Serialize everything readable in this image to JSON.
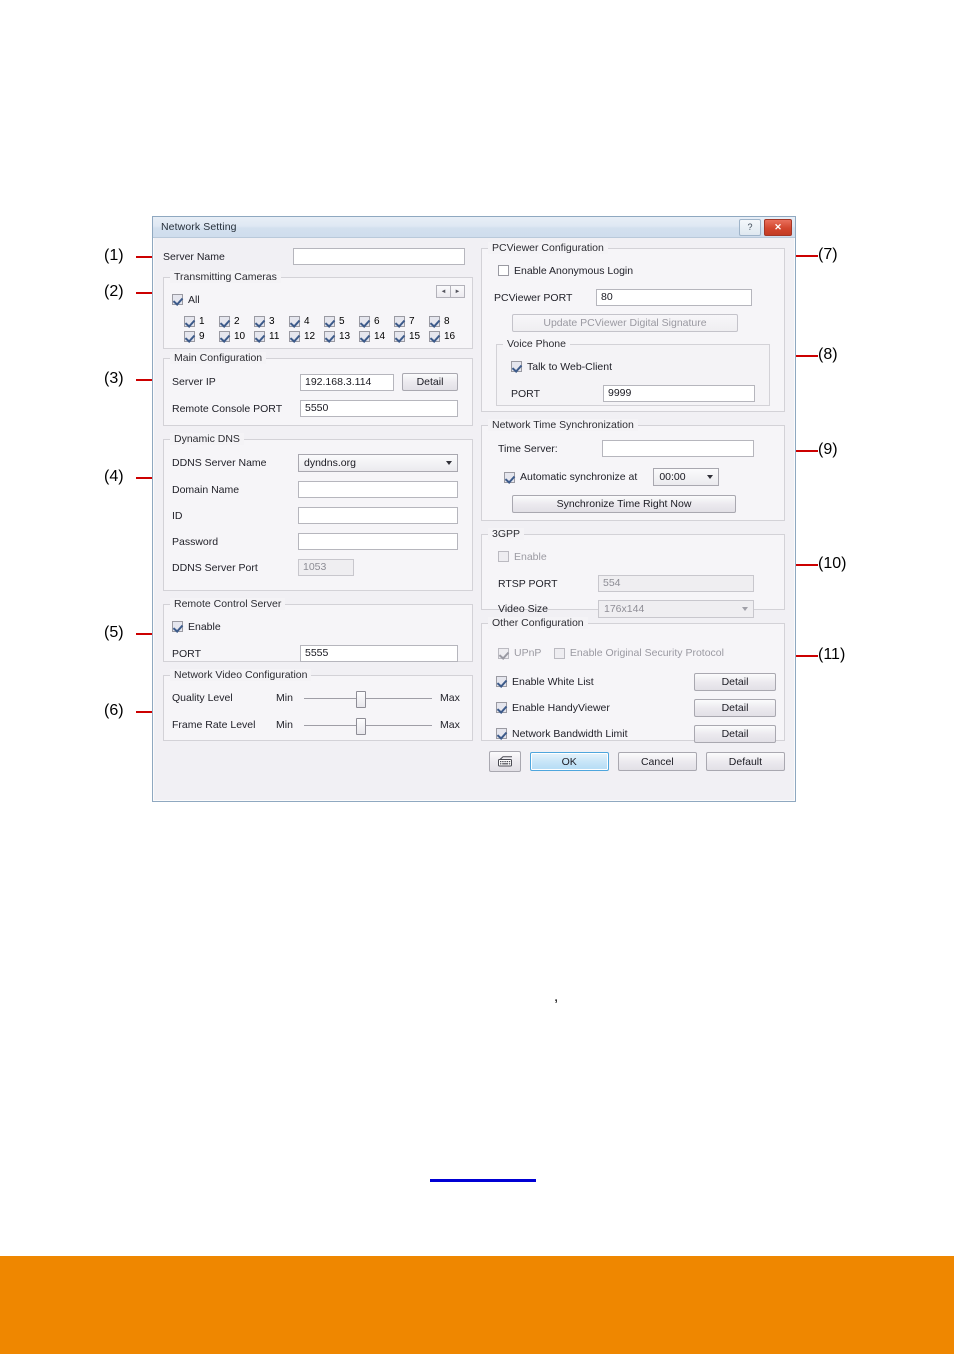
{
  "window": {
    "title": "Network Setting",
    "help_button": "?",
    "close_button": "✕"
  },
  "left": {
    "server_name": {
      "label": "Server Name",
      "value": "",
      "placeholder": ""
    },
    "transmitting_cameras": {
      "title": "Transmitting Cameras",
      "all_label": "All",
      "all_checked": true,
      "prev_arrow": "◄",
      "next_arrow": "►",
      "cameras": [
        {
          "label": "1",
          "checked": true
        },
        {
          "label": "2",
          "checked": true
        },
        {
          "label": "3",
          "checked": true
        },
        {
          "label": "4",
          "checked": true
        },
        {
          "label": "5",
          "checked": true
        },
        {
          "label": "6",
          "checked": true
        },
        {
          "label": "7",
          "checked": true
        },
        {
          "label": "8",
          "checked": true
        },
        {
          "label": "9",
          "checked": true
        },
        {
          "label": "10",
          "checked": true
        },
        {
          "label": "11",
          "checked": true
        },
        {
          "label": "12",
          "checked": true
        },
        {
          "label": "13",
          "checked": true
        },
        {
          "label": "14",
          "checked": true
        },
        {
          "label": "15",
          "checked": true
        },
        {
          "label": "16",
          "checked": true
        }
      ]
    },
    "main_configuration": {
      "title": "Main Configuration",
      "server_ip_label": "Server IP",
      "server_ip_value": "192.168.3.114",
      "detail_button": "Detail",
      "remote_console_port_label": "Remote Console PORT",
      "remote_console_port_value": "5550"
    },
    "dynamic_dns": {
      "title": "Dynamic DNS",
      "ddns_server_name_label": "DDNS Server Name",
      "ddns_server_name_value": "dyndns.org",
      "domain_name_label": "Domain Name",
      "domain_name_value": "",
      "id_label": "ID",
      "id_value": "",
      "password_label": "Password",
      "password_value": "",
      "ddns_server_port_label": "DDNS Server Port",
      "ddns_server_port_value": "1053"
    },
    "remote_control_server": {
      "title": "Remote Control Server",
      "enable_label": "Enable",
      "enable_checked": true,
      "port_label": "PORT",
      "port_value": "5555"
    },
    "network_video_configuration": {
      "title": "Network Video Configuration",
      "quality_label": "Quality Level",
      "quality_min": "Min",
      "quality_max": "Max",
      "quality_percent": 44,
      "framerate_label": "Frame Rate Level",
      "framerate_min": "Min",
      "framerate_max": "Max",
      "framerate_percent": 44
    }
  },
  "right": {
    "pcviewer_configuration": {
      "title": "PCViewer Configuration",
      "anonymous_login_label": "Enable Anonymous Login",
      "anonymous_login_checked": false,
      "port_label": "PCViewer PORT",
      "port_value": "80",
      "update_signature_button": "Update PCViewer Digital Signature",
      "voice_phone": {
        "title": "Voice Phone",
        "talk_label": "Talk to Web-Client",
        "talk_checked": true,
        "port_label": "PORT",
        "port_value": "9999"
      }
    },
    "network_time_sync": {
      "title": "Network Time Synchronization",
      "time_server_label": "Time Server:",
      "time_server_value": "",
      "auto_sync_label": "Automatic synchronize at",
      "auto_sync_checked": true,
      "auto_sync_time": "00:00",
      "sync_now_button": "Synchronize Time Right Now"
    },
    "threegpp": {
      "title": "3GPP",
      "enable_label": "Enable",
      "enable_checked": false,
      "rtsp_port_label": "RTSP PORT",
      "rtsp_port_value": "554",
      "video_size_label": "Video Size",
      "video_size_value": "176x144"
    },
    "other_configuration": {
      "title": "Other Configuration",
      "upnp_label": "UPnP",
      "upnp_checked": true,
      "original_security_label": "Enable Original Security Protocol",
      "original_security_checked": false,
      "white_list_label": "Enable White List",
      "white_list_checked": true,
      "white_list_detail": "Detail",
      "handyviewer_label": "Enable HandyViewer",
      "handyviewer_checked": true,
      "handyviewer_detail": "Detail",
      "bandwidth_label": "Network Bandwidth Limit",
      "bandwidth_checked": true,
      "bandwidth_detail": "Detail"
    },
    "footer": {
      "keyboard_icon": "keyboard-icon",
      "ok_button": "OK",
      "cancel_button": "Cancel",
      "default_button": "Default"
    }
  },
  "callouts": {
    "c1": "(1)",
    "c2": "(2)",
    "c3": "(3)",
    "c4": "(4)",
    "c5": "(5)",
    "c6": "(6)",
    "c7": "(7)",
    "c8": "(8)",
    "c9": "(9)",
    "c10": "(10)",
    "c11": "(11)"
  },
  "page_marks": {
    "comma": ","
  },
  "colors": {
    "callout_leader": "#cc0000",
    "orange_bar": "#ef8700",
    "link_underline": "#0000d4",
    "ok_accent": "#4ea6dd"
  }
}
